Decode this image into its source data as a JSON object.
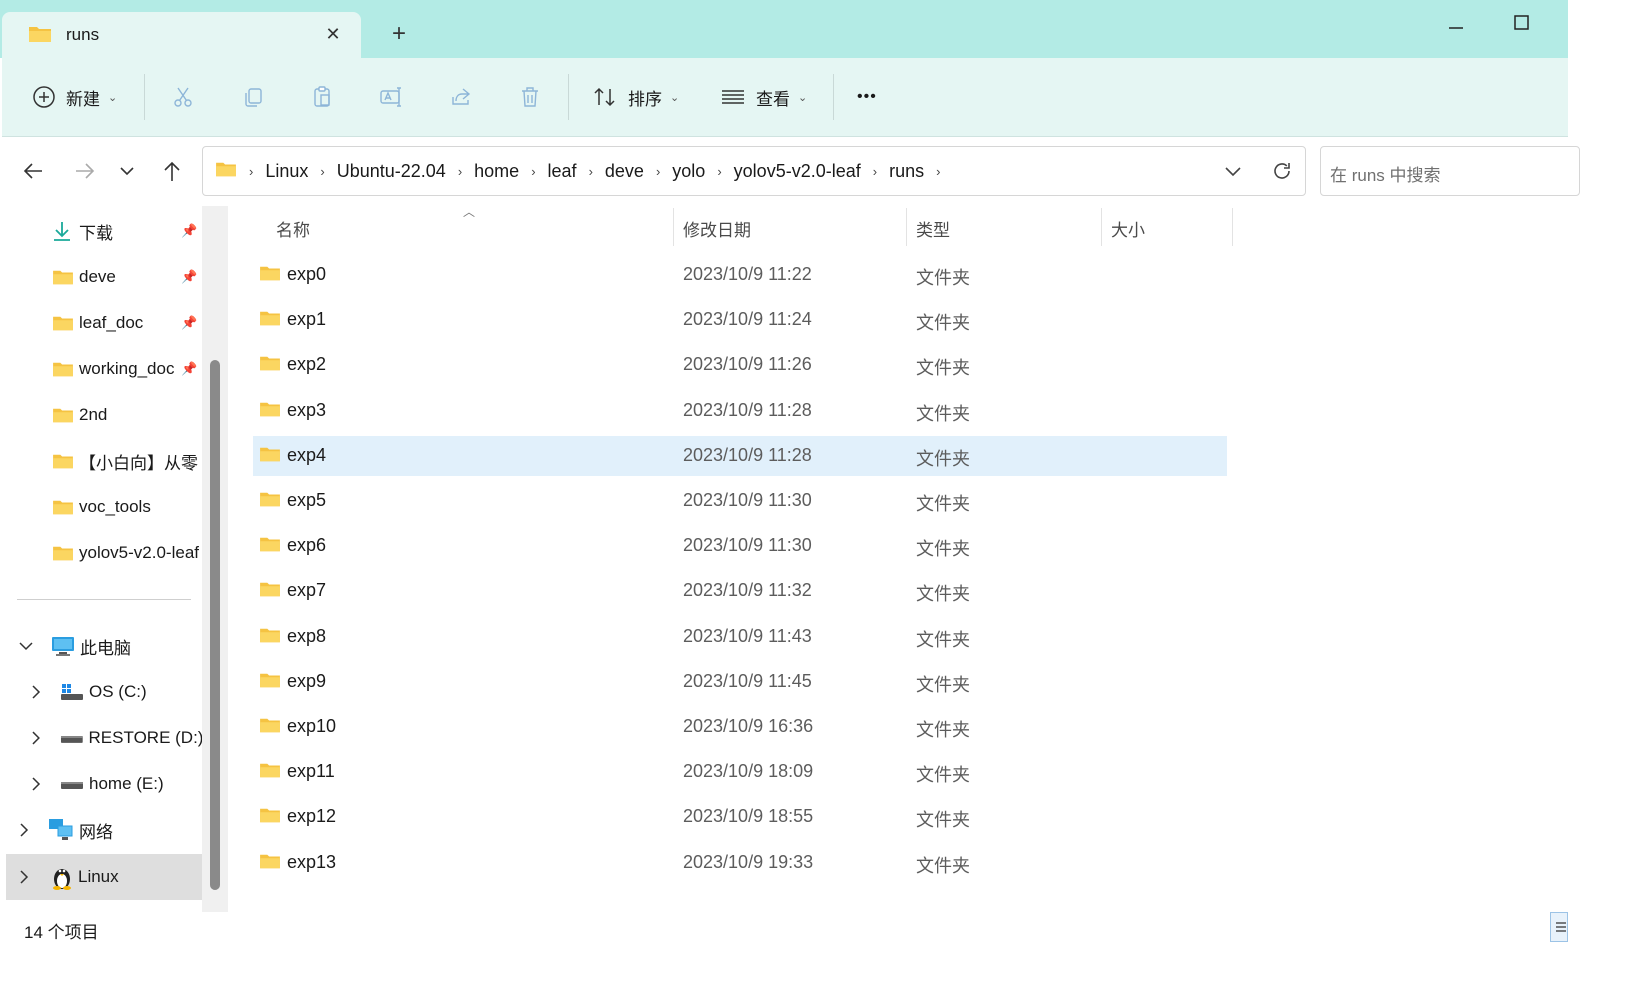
{
  "tab": {
    "title": "runs"
  },
  "toolbar": {
    "new_label": "新建",
    "sort_label": "排序",
    "view_label": "查看",
    "more_label": "•••"
  },
  "breadcrumb": [
    "Linux",
    "Ubuntu-22.04",
    "home",
    "leaf",
    "deve",
    "yolo",
    "yolov5-v2.0-leaf",
    "runs"
  ],
  "search": {
    "placeholder": "在 runs 中搜索"
  },
  "sidebar": {
    "quick": [
      {
        "label": "下载",
        "icon": "download-icon",
        "pinned": true
      },
      {
        "label": "deve",
        "icon": "folder-icon",
        "pinned": true
      },
      {
        "label": "leaf_doc",
        "icon": "folder-icon",
        "pinned": true
      },
      {
        "label": "working_doc",
        "icon": "folder-icon",
        "pinned": true
      },
      {
        "label": "2nd",
        "icon": "folder-icon",
        "pinned": false
      },
      {
        "label": "【小白向】从零",
        "icon": "folder-icon",
        "pinned": false
      },
      {
        "label": "voc_tools",
        "icon": "folder-icon",
        "pinned": false
      },
      {
        "label": "yolov5-v2.0-leaf",
        "icon": "folder-icon",
        "pinned": false
      }
    ],
    "this_pc": "此电脑",
    "drives": [
      "OS (C:)",
      "RESTORE (D:)",
      "home (E:)"
    ],
    "network": "网络",
    "linux": "Linux"
  },
  "columns": {
    "name": "名称",
    "modified": "修改日期",
    "type": "类型",
    "size": "大小"
  },
  "files": [
    {
      "name": "exp0",
      "modified": "2023/10/9 11:22",
      "type": "文件夹"
    },
    {
      "name": "exp1",
      "modified": "2023/10/9 11:24",
      "type": "文件夹"
    },
    {
      "name": "exp2",
      "modified": "2023/10/9 11:26",
      "type": "文件夹"
    },
    {
      "name": "exp3",
      "modified": "2023/10/9 11:28",
      "type": "文件夹"
    },
    {
      "name": "exp4",
      "modified": "2023/10/9 11:28",
      "type": "文件夹",
      "selected": true
    },
    {
      "name": "exp5",
      "modified": "2023/10/9 11:30",
      "type": "文件夹"
    },
    {
      "name": "exp6",
      "modified": "2023/10/9 11:30",
      "type": "文件夹"
    },
    {
      "name": "exp7",
      "modified": "2023/10/9 11:32",
      "type": "文件夹"
    },
    {
      "name": "exp8",
      "modified": "2023/10/9 11:43",
      "type": "文件夹"
    },
    {
      "name": "exp9",
      "modified": "2023/10/9 11:45",
      "type": "文件夹"
    },
    {
      "name": "exp10",
      "modified": "2023/10/9 16:36",
      "type": "文件夹"
    },
    {
      "name": "exp11",
      "modified": "2023/10/9 18:09",
      "type": "文件夹"
    },
    {
      "name": "exp12",
      "modified": "2023/10/9 18:55",
      "type": "文件夹"
    },
    {
      "name": "exp13",
      "modified": "2023/10/9 19:33",
      "type": "文件夹"
    }
  ],
  "status": {
    "count": "14 个项目"
  },
  "colors": {
    "title_bg": "#b3ebe5",
    "toolbar_bg": "#e5f6f3",
    "selection": "#e1f0fb",
    "folder": "#f5c342"
  }
}
